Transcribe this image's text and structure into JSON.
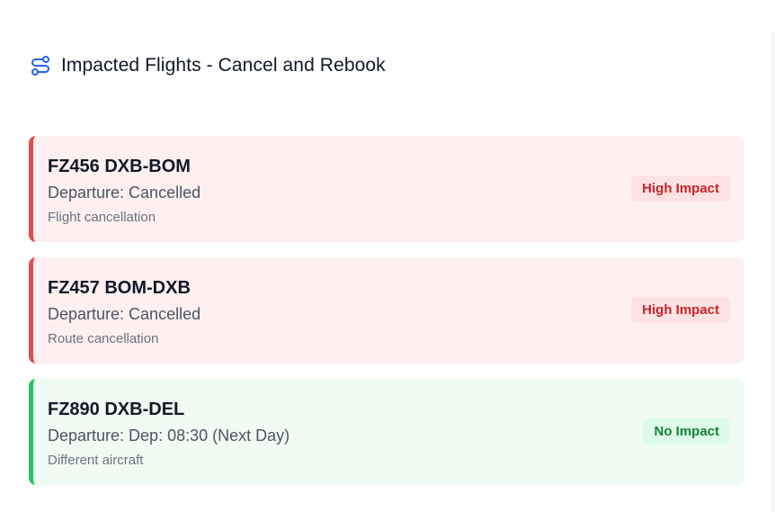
{
  "header": {
    "icon": "route-icon",
    "title": "Impacted Flights - Cancel and Rebook",
    "accent_color": "#2563eb"
  },
  "flights": [
    {
      "code": "FZ456 DXB-BOM",
      "departure": "Departure: Cancelled",
      "reason": "Flight cancellation",
      "impact": "High Impact",
      "impact_level": "high",
      "color": "#e5484d"
    },
    {
      "code": "FZ457 BOM-DXB",
      "departure": "Departure: Cancelled",
      "reason": "Route cancellation",
      "impact": "High Impact",
      "impact_level": "high",
      "color": "#e5484d"
    },
    {
      "code": "FZ890 DXB-DEL",
      "departure": "Departure: Dep: 08:30 (Next Day)",
      "reason": "Different aircraft",
      "impact": "No Impact",
      "impact_level": "none",
      "color": "#22c55e"
    }
  ]
}
